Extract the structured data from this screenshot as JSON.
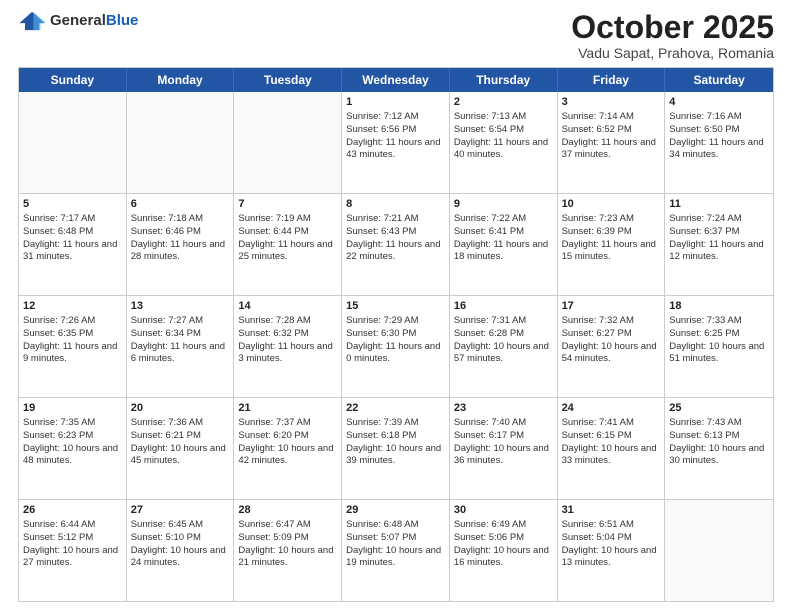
{
  "header": {
    "logo_general": "General",
    "logo_blue": "Blue",
    "month": "October 2025",
    "location": "Vadu Sapat, Prahova, Romania"
  },
  "weekdays": [
    "Sunday",
    "Monday",
    "Tuesday",
    "Wednesday",
    "Thursday",
    "Friday",
    "Saturday"
  ],
  "rows": [
    [
      {
        "day": "",
        "empty": true
      },
      {
        "day": "",
        "empty": true
      },
      {
        "day": "",
        "empty": true
      },
      {
        "day": "1",
        "sunrise": "Sunrise: 7:12 AM",
        "sunset": "Sunset: 6:56 PM",
        "daylight": "Daylight: 11 hours and 43 minutes."
      },
      {
        "day": "2",
        "sunrise": "Sunrise: 7:13 AM",
        "sunset": "Sunset: 6:54 PM",
        "daylight": "Daylight: 11 hours and 40 minutes."
      },
      {
        "day": "3",
        "sunrise": "Sunrise: 7:14 AM",
        "sunset": "Sunset: 6:52 PM",
        "daylight": "Daylight: 11 hours and 37 minutes."
      },
      {
        "day": "4",
        "sunrise": "Sunrise: 7:16 AM",
        "sunset": "Sunset: 6:50 PM",
        "daylight": "Daylight: 11 hours and 34 minutes."
      }
    ],
    [
      {
        "day": "5",
        "sunrise": "Sunrise: 7:17 AM",
        "sunset": "Sunset: 6:48 PM",
        "daylight": "Daylight: 11 hours and 31 minutes."
      },
      {
        "day": "6",
        "sunrise": "Sunrise: 7:18 AM",
        "sunset": "Sunset: 6:46 PM",
        "daylight": "Daylight: 11 hours and 28 minutes."
      },
      {
        "day": "7",
        "sunrise": "Sunrise: 7:19 AM",
        "sunset": "Sunset: 6:44 PM",
        "daylight": "Daylight: 11 hours and 25 minutes."
      },
      {
        "day": "8",
        "sunrise": "Sunrise: 7:21 AM",
        "sunset": "Sunset: 6:43 PM",
        "daylight": "Daylight: 11 hours and 22 minutes."
      },
      {
        "day": "9",
        "sunrise": "Sunrise: 7:22 AM",
        "sunset": "Sunset: 6:41 PM",
        "daylight": "Daylight: 11 hours and 18 minutes."
      },
      {
        "day": "10",
        "sunrise": "Sunrise: 7:23 AM",
        "sunset": "Sunset: 6:39 PM",
        "daylight": "Daylight: 11 hours and 15 minutes."
      },
      {
        "day": "11",
        "sunrise": "Sunrise: 7:24 AM",
        "sunset": "Sunset: 6:37 PM",
        "daylight": "Daylight: 11 hours and 12 minutes."
      }
    ],
    [
      {
        "day": "12",
        "sunrise": "Sunrise: 7:26 AM",
        "sunset": "Sunset: 6:35 PM",
        "daylight": "Daylight: 11 hours and 9 minutes."
      },
      {
        "day": "13",
        "sunrise": "Sunrise: 7:27 AM",
        "sunset": "Sunset: 6:34 PM",
        "daylight": "Daylight: 11 hours and 6 minutes."
      },
      {
        "day": "14",
        "sunrise": "Sunrise: 7:28 AM",
        "sunset": "Sunset: 6:32 PM",
        "daylight": "Daylight: 11 hours and 3 minutes."
      },
      {
        "day": "15",
        "sunrise": "Sunrise: 7:29 AM",
        "sunset": "Sunset: 6:30 PM",
        "daylight": "Daylight: 11 hours and 0 minutes."
      },
      {
        "day": "16",
        "sunrise": "Sunrise: 7:31 AM",
        "sunset": "Sunset: 6:28 PM",
        "daylight": "Daylight: 10 hours and 57 minutes."
      },
      {
        "day": "17",
        "sunrise": "Sunrise: 7:32 AM",
        "sunset": "Sunset: 6:27 PM",
        "daylight": "Daylight: 10 hours and 54 minutes."
      },
      {
        "day": "18",
        "sunrise": "Sunrise: 7:33 AM",
        "sunset": "Sunset: 6:25 PM",
        "daylight": "Daylight: 10 hours and 51 minutes."
      }
    ],
    [
      {
        "day": "19",
        "sunrise": "Sunrise: 7:35 AM",
        "sunset": "Sunset: 6:23 PM",
        "daylight": "Daylight: 10 hours and 48 minutes."
      },
      {
        "day": "20",
        "sunrise": "Sunrise: 7:36 AM",
        "sunset": "Sunset: 6:21 PM",
        "daylight": "Daylight: 10 hours and 45 minutes."
      },
      {
        "day": "21",
        "sunrise": "Sunrise: 7:37 AM",
        "sunset": "Sunset: 6:20 PM",
        "daylight": "Daylight: 10 hours and 42 minutes."
      },
      {
        "day": "22",
        "sunrise": "Sunrise: 7:39 AM",
        "sunset": "Sunset: 6:18 PM",
        "daylight": "Daylight: 10 hours and 39 minutes."
      },
      {
        "day": "23",
        "sunrise": "Sunrise: 7:40 AM",
        "sunset": "Sunset: 6:17 PM",
        "daylight": "Daylight: 10 hours and 36 minutes."
      },
      {
        "day": "24",
        "sunrise": "Sunrise: 7:41 AM",
        "sunset": "Sunset: 6:15 PM",
        "daylight": "Daylight: 10 hours and 33 minutes."
      },
      {
        "day": "25",
        "sunrise": "Sunrise: 7:43 AM",
        "sunset": "Sunset: 6:13 PM",
        "daylight": "Daylight: 10 hours and 30 minutes."
      }
    ],
    [
      {
        "day": "26",
        "sunrise": "Sunrise: 6:44 AM",
        "sunset": "Sunset: 5:12 PM",
        "daylight": "Daylight: 10 hours and 27 minutes."
      },
      {
        "day": "27",
        "sunrise": "Sunrise: 6:45 AM",
        "sunset": "Sunset: 5:10 PM",
        "daylight": "Daylight: 10 hours and 24 minutes."
      },
      {
        "day": "28",
        "sunrise": "Sunrise: 6:47 AM",
        "sunset": "Sunset: 5:09 PM",
        "daylight": "Daylight: 10 hours and 21 minutes."
      },
      {
        "day": "29",
        "sunrise": "Sunrise: 6:48 AM",
        "sunset": "Sunset: 5:07 PM",
        "daylight": "Daylight: 10 hours and 19 minutes."
      },
      {
        "day": "30",
        "sunrise": "Sunrise: 6:49 AM",
        "sunset": "Sunset: 5:06 PM",
        "daylight": "Daylight: 10 hours and 16 minutes."
      },
      {
        "day": "31",
        "sunrise": "Sunrise: 6:51 AM",
        "sunset": "Sunset: 5:04 PM",
        "daylight": "Daylight: 10 hours and 13 minutes."
      },
      {
        "day": "",
        "empty": true
      }
    ]
  ]
}
